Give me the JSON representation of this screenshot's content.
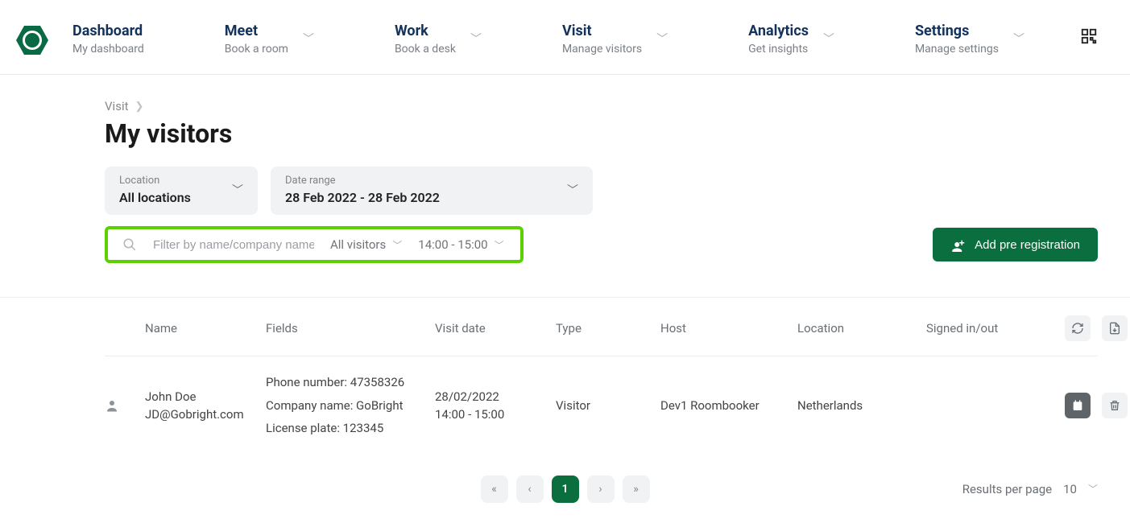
{
  "nav": [
    {
      "title": "Dashboard",
      "sub": "My dashboard",
      "chev": false
    },
    {
      "title": "Meet",
      "sub": "Book a room",
      "chev": true
    },
    {
      "title": "Work",
      "sub": "Book a desk",
      "chev": true
    },
    {
      "title": "Visit",
      "sub": "Manage visitors",
      "chev": true
    },
    {
      "title": "Analytics",
      "sub": "Get insights",
      "chev": true
    },
    {
      "title": "Settings",
      "sub": "Manage settings",
      "chev": true
    }
  ],
  "breadcrumb": {
    "root": "Visit"
  },
  "page": {
    "title": "My visitors"
  },
  "filters": {
    "location": {
      "label": "Location",
      "value": "All locations"
    },
    "daterange": {
      "label": "Date range",
      "value": "28 Feb 2022 - 28 Feb 2022"
    }
  },
  "search": {
    "placeholder": "Filter by name/company name",
    "visitor_dd": "All visitors",
    "time_dd": "14:00 - 15:00"
  },
  "add_button": "Add pre registration",
  "table": {
    "headers": {
      "name": "Name",
      "fields": "Fields",
      "visitdate": "Visit date",
      "type": "Type",
      "host": "Host",
      "location": "Location",
      "signed": "Signed in/out"
    },
    "rows": [
      {
        "name": "John Doe",
        "email": "JD@Gobright.com",
        "fields": [
          "Phone number: 47358326",
          "Company name: GoBright",
          "License plate: 123345"
        ],
        "date": "28/02/2022",
        "time": "14:00 - 15:00",
        "type": "Visitor",
        "host": "Dev1 Roombooker",
        "location": "Netherlands",
        "signed": ""
      }
    ]
  },
  "pagination": {
    "current": "1",
    "rpp_label": "Results per page",
    "rpp_value": "10"
  }
}
